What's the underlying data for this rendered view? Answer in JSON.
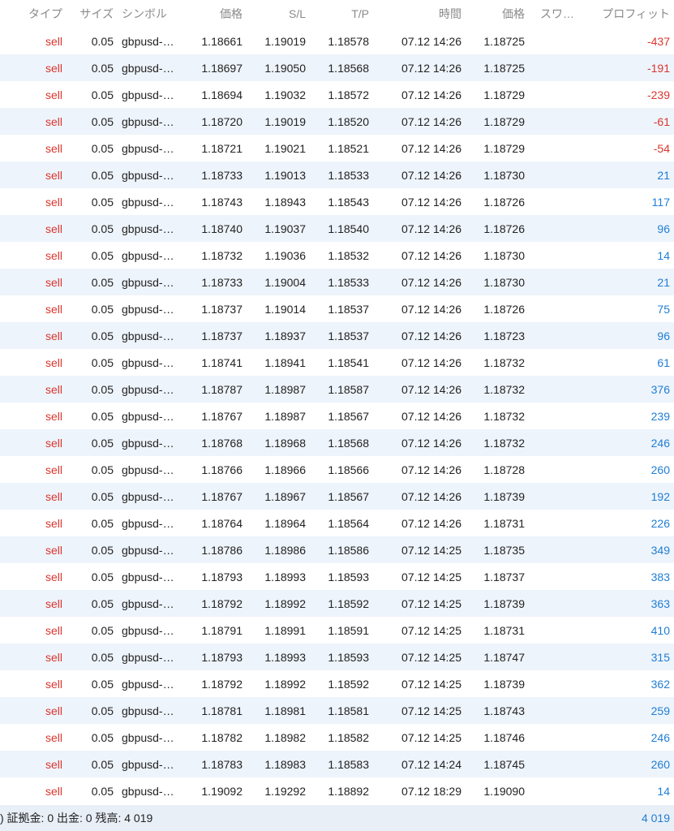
{
  "columns": {
    "type": "タイプ",
    "size": "サイズ",
    "symbol": "シンボル",
    "open_price": "価格",
    "sl": "S/L",
    "tp": "T/P",
    "time": "時間",
    "price": "価格",
    "swap": "スワ…",
    "profit": "プロフィット"
  },
  "rows": [
    {
      "type": "sell",
      "size": "0.05",
      "symbol": "gbpusd-…",
      "open_price": "1.18661",
      "sl": "1.19019",
      "tp": "1.18578",
      "time": "07.12 14:26",
      "price": "1.18725",
      "swap": "",
      "profit": "-437"
    },
    {
      "type": "sell",
      "size": "0.05",
      "symbol": "gbpusd-…",
      "open_price": "1.18697",
      "sl": "1.19050",
      "tp": "1.18568",
      "time": "07.12 14:26",
      "price": "1.18725",
      "swap": "",
      "profit": "-191"
    },
    {
      "type": "sell",
      "size": "0.05",
      "symbol": "gbpusd-…",
      "open_price": "1.18694",
      "sl": "1.19032",
      "tp": "1.18572",
      "time": "07.12 14:26",
      "price": "1.18729",
      "swap": "",
      "profit": "-239"
    },
    {
      "type": "sell",
      "size": "0.05",
      "symbol": "gbpusd-…",
      "open_price": "1.18720",
      "sl": "1.19019",
      "tp": "1.18520",
      "time": "07.12 14:26",
      "price": "1.18729",
      "swap": "",
      "profit": "-61"
    },
    {
      "type": "sell",
      "size": "0.05",
      "symbol": "gbpusd-…",
      "open_price": "1.18721",
      "sl": "1.19021",
      "tp": "1.18521",
      "time": "07.12 14:26",
      "price": "1.18729",
      "swap": "",
      "profit": "-54"
    },
    {
      "type": "sell",
      "size": "0.05",
      "symbol": "gbpusd-…",
      "open_price": "1.18733",
      "sl": "1.19013",
      "tp": "1.18533",
      "time": "07.12 14:26",
      "price": "1.18730",
      "swap": "",
      "profit": "21"
    },
    {
      "type": "sell",
      "size": "0.05",
      "symbol": "gbpusd-…",
      "open_price": "1.18743",
      "sl": "1.18943",
      "tp": "1.18543",
      "time": "07.12 14:26",
      "price": "1.18726",
      "swap": "",
      "profit": "117"
    },
    {
      "type": "sell",
      "size": "0.05",
      "symbol": "gbpusd-…",
      "open_price": "1.18740",
      "sl": "1.19037",
      "tp": "1.18540",
      "time": "07.12 14:26",
      "price": "1.18726",
      "swap": "",
      "profit": "96"
    },
    {
      "type": "sell",
      "size": "0.05",
      "symbol": "gbpusd-…",
      "open_price": "1.18732",
      "sl": "1.19036",
      "tp": "1.18532",
      "time": "07.12 14:26",
      "price": "1.18730",
      "swap": "",
      "profit": "14"
    },
    {
      "type": "sell",
      "size": "0.05",
      "symbol": "gbpusd-…",
      "open_price": "1.18733",
      "sl": "1.19004",
      "tp": "1.18533",
      "time": "07.12 14:26",
      "price": "1.18730",
      "swap": "",
      "profit": "21"
    },
    {
      "type": "sell",
      "size": "0.05",
      "symbol": "gbpusd-…",
      "open_price": "1.18737",
      "sl": "1.19014",
      "tp": "1.18537",
      "time": "07.12 14:26",
      "price": "1.18726",
      "swap": "",
      "profit": "75"
    },
    {
      "type": "sell",
      "size": "0.05",
      "symbol": "gbpusd-…",
      "open_price": "1.18737",
      "sl": "1.18937",
      "tp": "1.18537",
      "time": "07.12 14:26",
      "price": "1.18723",
      "swap": "",
      "profit": "96"
    },
    {
      "type": "sell",
      "size": "0.05",
      "symbol": "gbpusd-…",
      "open_price": "1.18741",
      "sl": "1.18941",
      "tp": "1.18541",
      "time": "07.12 14:26",
      "price": "1.18732",
      "swap": "",
      "profit": "61"
    },
    {
      "type": "sell",
      "size": "0.05",
      "symbol": "gbpusd-…",
      "open_price": "1.18787",
      "sl": "1.18987",
      "tp": "1.18587",
      "time": "07.12 14:26",
      "price": "1.18732",
      "swap": "",
      "profit": "376"
    },
    {
      "type": "sell",
      "size": "0.05",
      "symbol": "gbpusd-…",
      "open_price": "1.18767",
      "sl": "1.18987",
      "tp": "1.18567",
      "time": "07.12 14:26",
      "price": "1.18732",
      "swap": "",
      "profit": "239"
    },
    {
      "type": "sell",
      "size": "0.05",
      "symbol": "gbpusd-…",
      "open_price": "1.18768",
      "sl": "1.18968",
      "tp": "1.18568",
      "time": "07.12 14:26",
      "price": "1.18732",
      "swap": "",
      "profit": "246"
    },
    {
      "type": "sell",
      "size": "0.05",
      "symbol": "gbpusd-…",
      "open_price": "1.18766",
      "sl": "1.18966",
      "tp": "1.18566",
      "time": "07.12 14:26",
      "price": "1.18728",
      "swap": "",
      "profit": "260"
    },
    {
      "type": "sell",
      "size": "0.05",
      "symbol": "gbpusd-…",
      "open_price": "1.18767",
      "sl": "1.18967",
      "tp": "1.18567",
      "time": "07.12 14:26",
      "price": "1.18739",
      "swap": "",
      "profit": "192"
    },
    {
      "type": "sell",
      "size": "0.05",
      "symbol": "gbpusd-…",
      "open_price": "1.18764",
      "sl": "1.18964",
      "tp": "1.18564",
      "time": "07.12 14:26",
      "price": "1.18731",
      "swap": "",
      "profit": "226"
    },
    {
      "type": "sell",
      "size": "0.05",
      "symbol": "gbpusd-…",
      "open_price": "1.18786",
      "sl": "1.18986",
      "tp": "1.18586",
      "time": "07.12 14:25",
      "price": "1.18735",
      "swap": "",
      "profit": "349"
    },
    {
      "type": "sell",
      "size": "0.05",
      "symbol": "gbpusd-…",
      "open_price": "1.18793",
      "sl": "1.18993",
      "tp": "1.18593",
      "time": "07.12 14:25",
      "price": "1.18737",
      "swap": "",
      "profit": "383"
    },
    {
      "type": "sell",
      "size": "0.05",
      "symbol": "gbpusd-…",
      "open_price": "1.18792",
      "sl": "1.18992",
      "tp": "1.18592",
      "time": "07.12 14:25",
      "price": "1.18739",
      "swap": "",
      "profit": "363"
    },
    {
      "type": "sell",
      "size": "0.05",
      "symbol": "gbpusd-…",
      "open_price": "1.18791",
      "sl": "1.18991",
      "tp": "1.18591",
      "time": "07.12 14:25",
      "price": "1.18731",
      "swap": "",
      "profit": "410"
    },
    {
      "type": "sell",
      "size": "0.05",
      "symbol": "gbpusd-…",
      "open_price": "1.18793",
      "sl": "1.18993",
      "tp": "1.18593",
      "time": "07.12 14:25",
      "price": "1.18747",
      "swap": "",
      "profit": "315"
    },
    {
      "type": "sell",
      "size": "0.05",
      "symbol": "gbpusd-…",
      "open_price": "1.18792",
      "sl": "1.18992",
      "tp": "1.18592",
      "time": "07.12 14:25",
      "price": "1.18739",
      "swap": "",
      "profit": "362"
    },
    {
      "type": "sell",
      "size": "0.05",
      "symbol": "gbpusd-…",
      "open_price": "1.18781",
      "sl": "1.18981",
      "tp": "1.18581",
      "time": "07.12 14:25",
      "price": "1.18743",
      "swap": "",
      "profit": "259"
    },
    {
      "type": "sell",
      "size": "0.05",
      "symbol": "gbpusd-…",
      "open_price": "1.18782",
      "sl": "1.18982",
      "tp": "1.18582",
      "time": "07.12 14:25",
      "price": "1.18746",
      "swap": "",
      "profit": "246"
    },
    {
      "type": "sell",
      "size": "0.05",
      "symbol": "gbpusd-…",
      "open_price": "1.18783",
      "sl": "1.18983",
      "tp": "1.18583",
      "time": "07.12 14:24",
      "price": "1.18745",
      "swap": "",
      "profit": "260"
    },
    {
      "type": "sell",
      "size": "0.05",
      "symbol": "gbpusd-…",
      "open_price": "1.19092",
      "sl": "1.19292",
      "tp": "1.18892",
      "time": "07.12 18:29",
      "price": "1.19090",
      "swap": "",
      "profit": "14"
    }
  ],
  "footer": {
    "summary": ") 証拠金: 0 出金: 0 残高: 4 019",
    "total": "4 019"
  },
  "colors": {
    "sell": "#d9352e",
    "negative": "#d9352e",
    "positive": "#1f7ed6",
    "header_text": "#8a8a8a",
    "alt_row": "#eef4fb",
    "footer_bg": "#e9eff7"
  }
}
